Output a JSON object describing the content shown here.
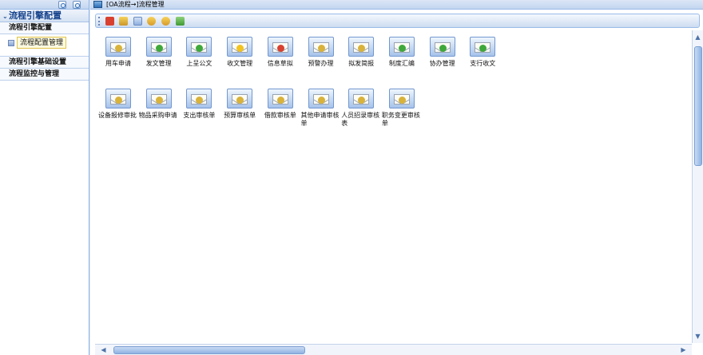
{
  "sidebar": {
    "top_buttons": [
      "refresh-icon",
      "collapse-icon"
    ],
    "group_title": "流程引擎配置",
    "items": [
      {
        "label": "流程引擎配置"
      },
      {
        "label": "流程配置管理",
        "selected": true
      },
      {
        "label": "流程引擎基础设置"
      },
      {
        "label": "流程监控与管理"
      }
    ]
  },
  "main": {
    "title": "[OA流程→]流程管理",
    "toolbar_icons": [
      "stop-icon",
      "forward-icon",
      "grid-icon",
      "back-icon",
      "next-icon",
      "edit-icon"
    ],
    "icons": [
      {
        "label": "用车申请",
        "badge": "#d8b23a"
      },
      {
        "label": "发文管理",
        "badge": "#3fa83a"
      },
      {
        "label": "上呈公文",
        "badge": "#3fa83a"
      },
      {
        "label": "收文管理",
        "badge": "#f2c21f"
      },
      {
        "label": "信息草拟",
        "badge": "#d8412f"
      },
      {
        "label": "预警办理",
        "badge": "#d8b23a"
      },
      {
        "label": "拟发简报",
        "badge": "#d8b23a"
      },
      {
        "label": "制度汇编",
        "badge": "#3fa83a"
      },
      {
        "label": "协办管理",
        "badge": "#3fa83a"
      },
      {
        "label": "支行收文",
        "badge": "#3fa83a"
      },
      {
        "label": "设备报修审批",
        "badge": "#d8b23a"
      },
      {
        "label": "物品采购申请",
        "badge": "#d8b23a"
      },
      {
        "label": "支出审核单",
        "badge": "#d8b23a"
      },
      {
        "label": "预算审核单",
        "badge": "#d8b23a"
      },
      {
        "label": "借款审核单",
        "badge": "#d8b23a"
      },
      {
        "label": "其他申请审核单",
        "badge": "#d8b23a"
      },
      {
        "label": "人员招录审核表",
        "badge": "#d8b23a"
      },
      {
        "label": "职务变更审核单",
        "badge": "#d8b23a"
      }
    ]
  },
  "colors": {
    "accent": "#15428b",
    "border": "#99bbe8",
    "selected_bg": "#fdfbe0"
  }
}
